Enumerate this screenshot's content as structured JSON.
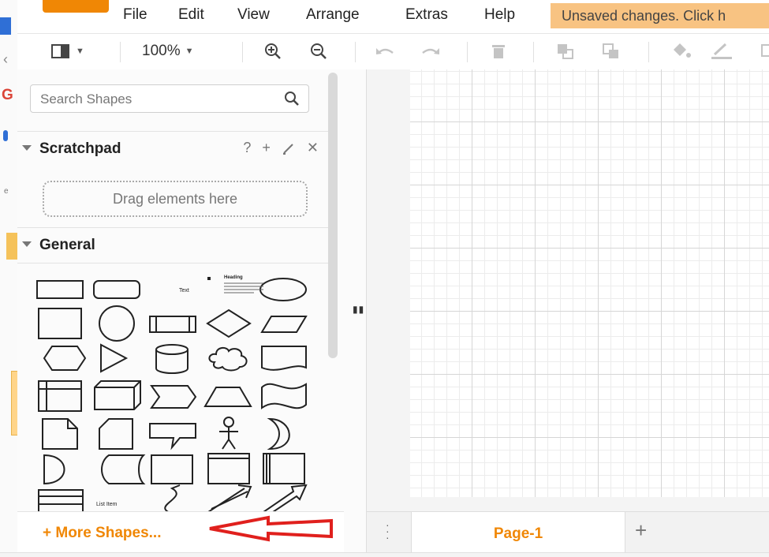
{
  "menubar": {
    "items": [
      "File",
      "Edit",
      "View",
      "Arrange",
      "Extras",
      "Help"
    ],
    "unsaved": "Unsaved changes. Click h"
  },
  "toolbar": {
    "zoom": "100%",
    "icons": [
      "format-panel-icon",
      "zoom-in-icon",
      "zoom-out-icon",
      "undo-icon",
      "redo-icon",
      "delete-icon",
      "to-front-icon",
      "to-back-icon",
      "fill-color-icon",
      "line-color-icon"
    ]
  },
  "sidebar": {
    "search_placeholder": "Search Shapes",
    "scratchpad": {
      "title": "Scratchpad",
      "help": "?",
      "add": "+",
      "close": "✕",
      "drop_hint": "Drag elements here"
    },
    "general": {
      "title": "General",
      "text_shape_label": "Text",
      "heading_shape_label": "Heading",
      "list_item_label": "List Item"
    }
  },
  "bottom": {
    "more_shapes": "+ More Shapes...",
    "page_tab": "Page-1",
    "add_page": "+"
  },
  "colors": {
    "accent": "#f08705",
    "unsaved_bg": "#f8c382",
    "annotation": "#e0201d"
  }
}
